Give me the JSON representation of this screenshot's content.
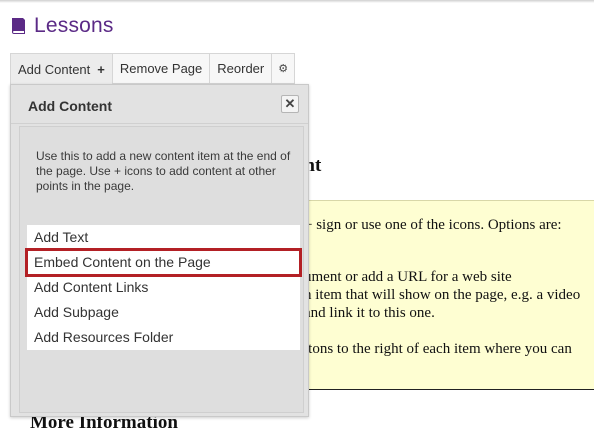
{
  "header": {
    "title": "Lessons",
    "icon": "book-icon",
    "color": "#5b2a86"
  },
  "toolbar": {
    "add_content_label": "Add Content",
    "remove_page_label": "Remove Page",
    "reorder_label": "Reorder",
    "plus_icon": "plus-icon",
    "gear_icon": "gear-icon"
  },
  "dialog": {
    "title": "Add Content",
    "close_icon": "close-icon",
    "description": "Use this to add a new content item at the end of the page. Use + icons to add content at other points in the page.",
    "items": [
      {
        "label": "Add Text"
      },
      {
        "label": "Embed Content on the Page",
        "highlighted": true
      },
      {
        "label": "Add Content Links"
      },
      {
        "label": "Add Subpage"
      },
      {
        "label": "Add Resources Folder"
      }
    ],
    "highlight_color": "#b32025"
  },
  "background": {
    "heading": "ent",
    "lines": [
      "+ sign or use one of the icons. Options are:",
      "r",
      "ument or add a URL for a web site",
      "n item that will show on the page, e.g. a video",
      " and link it to this one.",
      "ttons to the right of each item where you can"
    ],
    "more_info": "More Information",
    "box_color": "#fefed2"
  }
}
